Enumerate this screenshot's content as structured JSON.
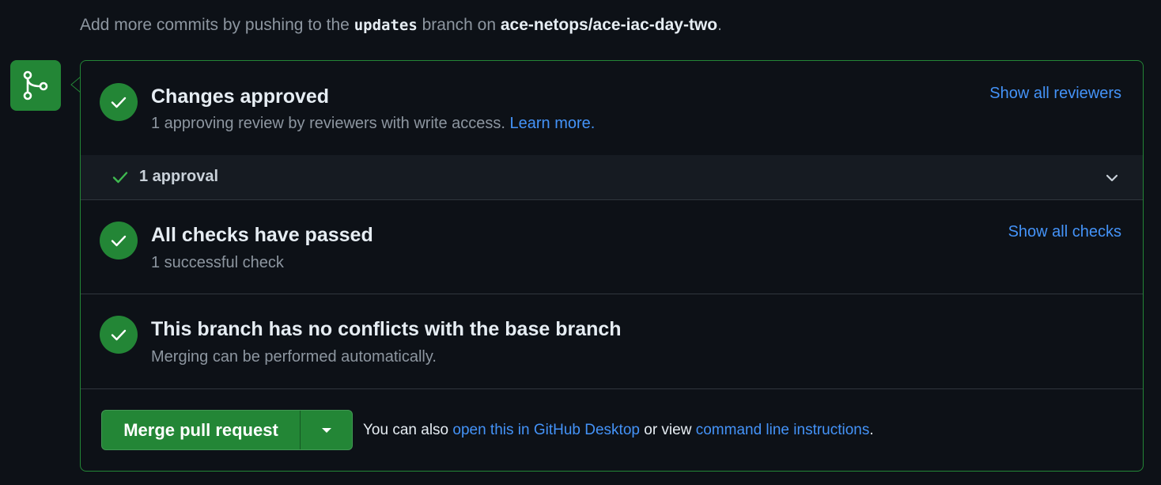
{
  "intro": {
    "prefix": "Add more commits by pushing to the",
    "branch": "updates",
    "middle": "branch on",
    "repo": "ace-netops/ace-iac-day-two",
    "suffix": "."
  },
  "reviews": {
    "title": "Changes approved",
    "subtitle": "1 approving review by reviewers with write access.",
    "learn_more": "Learn more.",
    "show_all": "Show all reviewers",
    "approval_count": "1 approval"
  },
  "checks": {
    "title": "All checks have passed",
    "subtitle": "1 successful check",
    "show_all": "Show all checks"
  },
  "conflicts": {
    "title": "This branch has no conflicts with the base branch",
    "subtitle": "Merging can be performed automatically."
  },
  "merge": {
    "button_label": "Merge pull request",
    "also_prefix": "You can also",
    "desktop_link": "open this in GitHub Desktop",
    "or_view": "or view",
    "cli_link": "command line instructions",
    "suffix": "."
  },
  "colors": {
    "success": "#238636",
    "link": "#4493f8",
    "background": "#0d1117"
  }
}
